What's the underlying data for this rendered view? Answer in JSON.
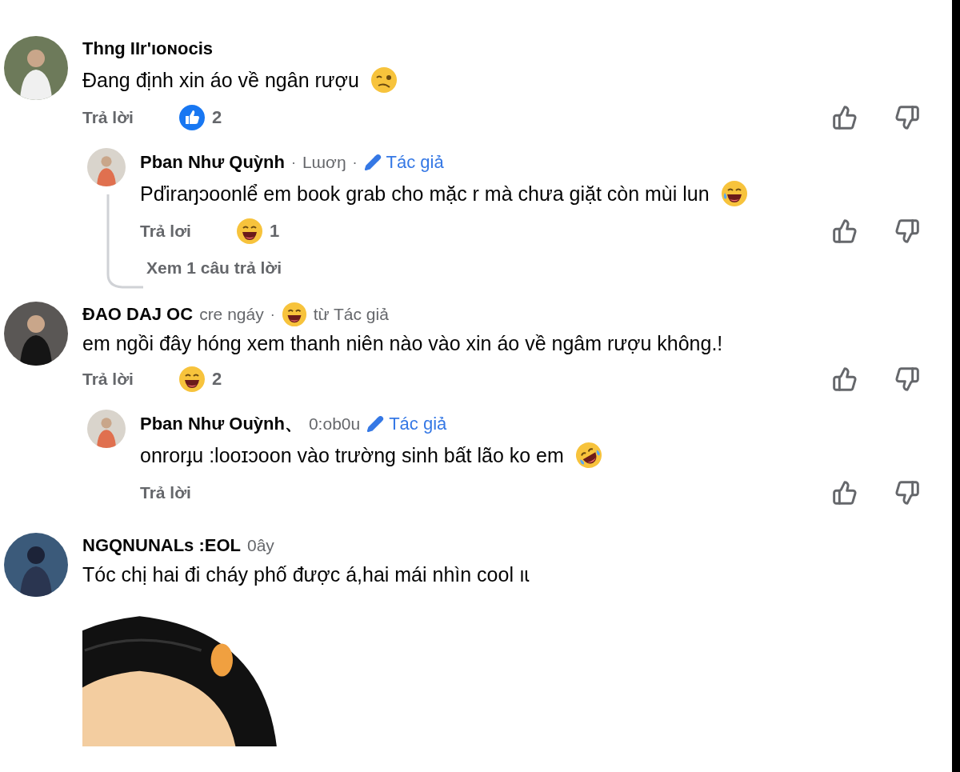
{
  "comments": [
    {
      "author": "Thng IIr'ıoɴocis",
      "avatar": {
        "kind": "man"
      },
      "text": "Đang định xin áo về ngân rượu",
      "emoji": {
        "kind": "woozy"
      },
      "reply_label": "Trả lời",
      "reaction": {
        "kind": "like",
        "count": "2"
      },
      "replies": [
        {
          "author": "Pban Như Quỳnh",
          "meta": [
            {
              "kind": "dot",
              "text": "·"
            },
            {
              "kind": "time",
              "text": "Lɯơŋ"
            },
            {
              "kind": "dot",
              "text": "·"
            },
            {
              "kind": "author",
              "text": "Tác giả"
            }
          ],
          "avatar": {
            "kind": "woman"
          },
          "text": "Pďiraŋɔoonlể em book grab cho mặc r mà chưa giặt còn mùi lun",
          "emoji": {
            "kind": "joy"
          },
          "reply_label": "Trả lơi",
          "reaction": {
            "kind": "haha",
            "count": "1"
          }
        }
      ],
      "view_replies": "Xem 1 câu trả lời"
    },
    {
      "author": "ĐAO DAJ OC",
      "meta": [
        {
          "kind": "time",
          "text": "cre ngáy"
        },
        {
          "kind": "dot",
          "text": "·"
        },
        {
          "kind": "reacted",
          "text": "từ Tác giả"
        }
      ],
      "avatar": {
        "kind": "man2"
      },
      "text": "em ngồi đây hóng xem thanh niên nào vào xin áo về ngâm rượu không.!",
      "reply_label": "Trả lời",
      "reaction": {
        "kind": "haha",
        "count": "2"
      },
      "replies": [
        {
          "author": "Pban Như Ouỳnh、",
          "meta": [
            {
              "kind": "time",
              "text": "0:ob0u"
            },
            {
              "kind": "author",
              "text": "Tác giả"
            }
          ],
          "avatar": {
            "kind": "woman"
          },
          "text": "onrorɟu :looɪɔoon vào trường sinh bất lão ko em",
          "emoji": {
            "kind": "rofl"
          },
          "reply_label": "Trả lời"
        }
      ]
    },
    {
      "author": "NGQNUNALs :EOL",
      "meta": [
        {
          "kind": "time",
          "text": "0ây"
        }
      ],
      "avatar": {
        "kind": "anime"
      },
      "text": "Tóc chị hai đi cháy phố được á,hai mái nhìn cool ıɩ",
      "attachment": {
        "kind": "picture"
      }
    }
  ]
}
